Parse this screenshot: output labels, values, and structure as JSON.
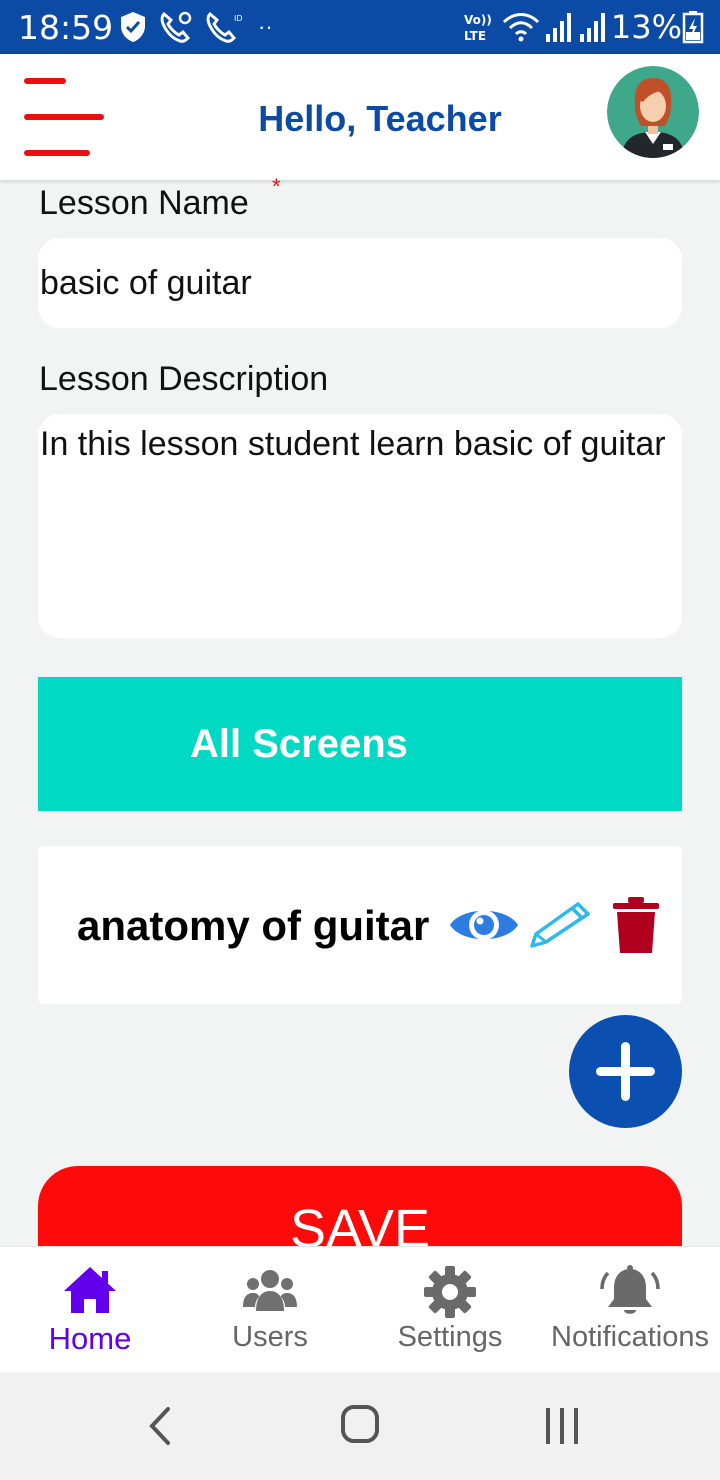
{
  "status_bar": {
    "time": "18:59",
    "battery": "13%",
    "icons": [
      "shield-icon",
      "wifi-calling-icon",
      "call-icon",
      "volte-icon",
      "wifi-icon",
      "signal-icon",
      "battery-icon"
    ]
  },
  "header": {
    "title": "Hello, Teacher",
    "menu_icon": "hamburger-menu-icon",
    "avatar": "teacher-avatar"
  },
  "form": {
    "lesson_name_label": "Lesson Name",
    "required_marker": "*",
    "lesson_name_value": "basic of guitar",
    "lesson_description_label": "Lesson Description",
    "lesson_description_value": "In this lesson student learn basic of guitar"
  },
  "all_screens_label": "All Screens",
  "screens": [
    {
      "title": "anatomy of guitar",
      "actions": [
        "eye-icon",
        "pencil-icon",
        "trash-icon"
      ]
    }
  ],
  "add_button_icon": "plus-icon",
  "save_label": "SAVE",
  "bottom_nav": {
    "items": [
      {
        "label": "Home",
        "icon": "home-icon",
        "active": true
      },
      {
        "label": "Users",
        "icon": "users-icon",
        "active": false
      },
      {
        "label": "Settings",
        "icon": "gear-icon",
        "active": false
      },
      {
        "label": "Notifications",
        "icon": "bell-icon",
        "active": false
      }
    ]
  },
  "colors": {
    "primary_blue": "#0b4aa5",
    "accent_teal": "#00d9c4",
    "save_red": "#ff0a0a",
    "menu_red": "#e81010",
    "active_nav": "#6200ee",
    "trash_red": "#b0001e",
    "eye_blue": "#2b7de1"
  }
}
